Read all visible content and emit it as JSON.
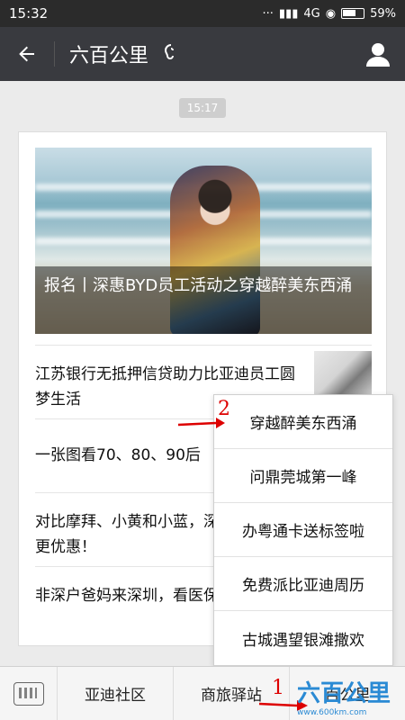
{
  "status": {
    "time": "15:32",
    "network": "4G",
    "battery": "59%"
  },
  "header": {
    "back_icon": "back-arrow-icon",
    "title": "六百公里",
    "ear_icon": "ear-icon",
    "profile_icon": "profile-icon"
  },
  "timestamp": "15:17",
  "article": {
    "hero_caption": "报名丨深惠BYD员工活动之穿越醉美东西涌",
    "items": [
      {
        "text": "江苏银行无抵押信贷助力比亚迪员工圆梦生活"
      },
      {
        "text": "一张图看70、80、90后"
      },
      {
        "text": "对比摩拜、小黄和小蓝，深圳这样租车更优惠！"
      },
      {
        "text": "非深户爸妈来深圳，看医保卡啦！"
      }
    ]
  },
  "popup": {
    "options": [
      "穿越醉美东西涌",
      "问鼎莞城第一峰",
      "办粤通卡送标签啦",
      "免费派比亚迪周历",
      "古城遇望银滩撒欢"
    ]
  },
  "tabbar": {
    "keyboard_icon": "keyboard-icon",
    "tabs": [
      "亚迪社区",
      "商旅驿站",
      "百公里"
    ]
  },
  "annotations": {
    "num1": "1",
    "num2": "2"
  },
  "watermark": {
    "text": "六百公里",
    "url": "www.600km.com"
  },
  "colors": {
    "header_bg": "#393a3f",
    "status_bg": "#2b2b2b",
    "annotation_red": "#d00000",
    "watermark_blue": "#2a8ad4"
  }
}
